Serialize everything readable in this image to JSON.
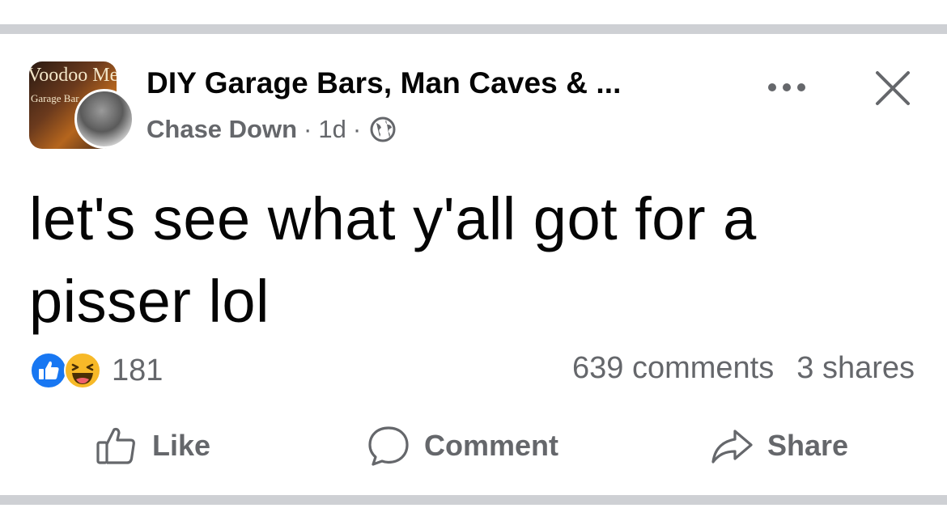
{
  "post": {
    "group_avatar_lines": [
      "Voodoo Me",
      "Garage Bar"
    ],
    "group_name": "DIY Garage Bars, Man Caves & ...",
    "author": "Chase Down",
    "separator": "·",
    "time": "1d",
    "text_line1": "let's see what y'all got for a",
    "text_line2": "pisser lol",
    "reactions": {
      "icons": [
        "like-icon",
        "haha-icon"
      ],
      "count": "181"
    },
    "comments_text": "639 comments",
    "shares_text": "3 shares"
  },
  "actions": {
    "like_label": "Like",
    "comment_label": "Comment",
    "share_label": "Share"
  },
  "colors": {
    "text_primary": "#050505",
    "text_secondary": "#65676b",
    "like_blue": "#1877f2",
    "haha_yellow": "#f7b928",
    "divider": "#ced0d4"
  }
}
